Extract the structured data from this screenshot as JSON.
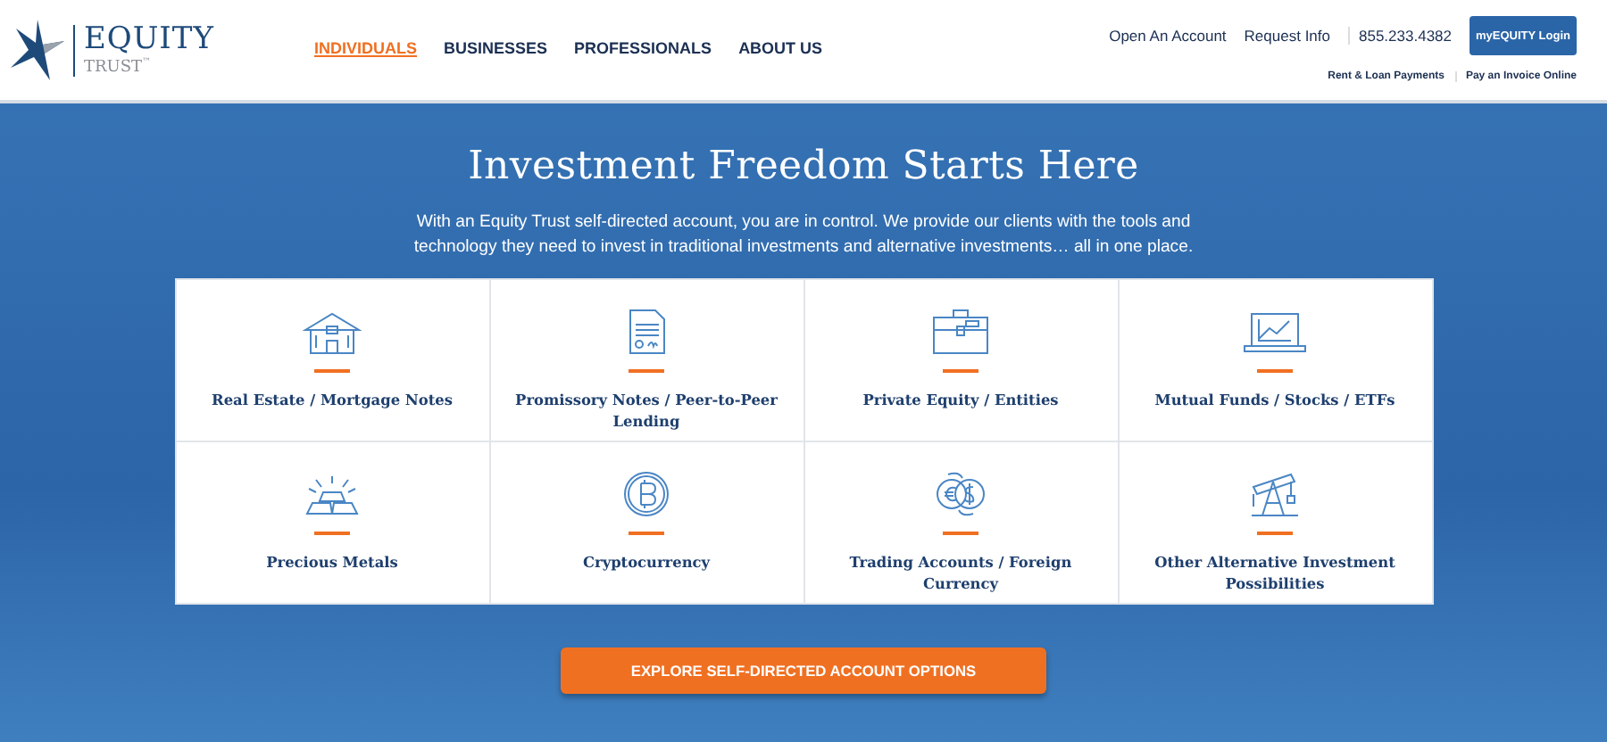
{
  "logo": {
    "name": "EQUITY",
    "sub": "TRUST",
    "mark": "™"
  },
  "nav": [
    {
      "label": "INDIVIDUALS",
      "selected": true
    },
    {
      "label": "BUSINESSES",
      "selected": false
    },
    {
      "label": "PROFESSIONALS",
      "selected": false
    },
    {
      "label": "ABOUT US",
      "selected": false
    }
  ],
  "top_links": [
    "Open An Account",
    "Request Info",
    "855.233.4382"
  ],
  "login_button": "myEQUITY Login",
  "sub_links": [
    "Rent & Loan Payments",
    "Pay an Invoice Online"
  ],
  "hero": {
    "title": "Investment Freedom Starts Here",
    "text": "With an Equity Trust self-directed account, you are in control. We provide our clients with the tools and technology they need to invest in traditional investments and alternative investments… all in one place."
  },
  "categories": [
    {
      "label": "Real Estate / Mortgage Notes"
    },
    {
      "label": "Promissory Notes / Peer-to-Peer Lending"
    },
    {
      "label": "Private Equity / Entities"
    },
    {
      "label": "Mutual Funds / Stocks / ETFs"
    },
    {
      "label": "Precious Metals"
    },
    {
      "label": "Cryptocurrency"
    },
    {
      "label": "Trading Accounts / Foreign Currency"
    },
    {
      "label": "Other Alternative Investment Possibilities"
    }
  ],
  "cta_button": "EXPLORE SELF-DIRECTED ACCOUNT OPTIONS"
}
